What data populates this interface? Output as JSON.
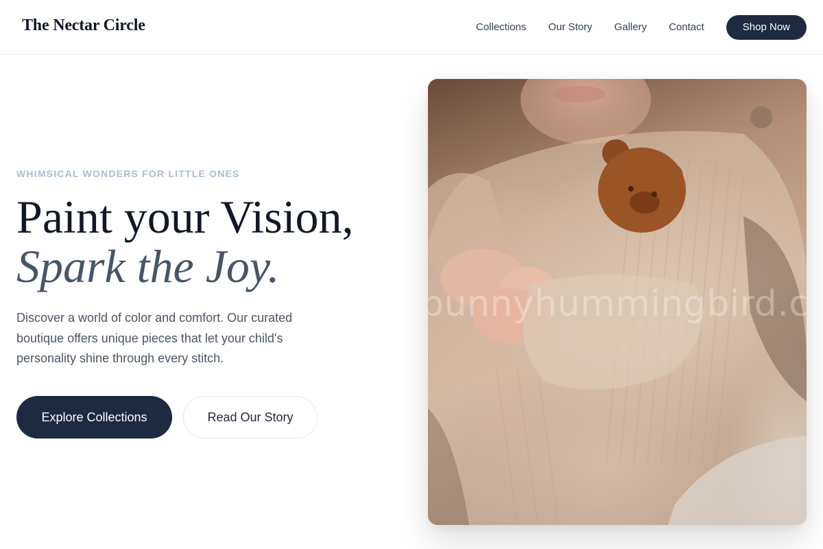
{
  "header": {
    "logo": "The Nectar Circle",
    "nav": [
      "Collections",
      "Our Story",
      "Gallery",
      "Contact"
    ],
    "cta": "Shop Now"
  },
  "hero": {
    "eyebrow": "WHIMSICAL WONDERS FOR LITTLE ONES",
    "headline_line1": "Paint your Vision,",
    "headline_line2": "Spark the Joy.",
    "description": "Discover a world of color and comfort. Our curated boutique offers unique pieces that let your child's personality shine through every stitch.",
    "primary_button": "Explore Collections",
    "secondary_button": "Read Our Story",
    "image_watermark": "bunnyhummingbird.com"
  },
  "colors": {
    "primary": "#1e2a3f",
    "eyebrow": "#a9bdd6",
    "headline": "#111827",
    "headline_italic": "#475569",
    "body_text": "#4b5563"
  }
}
